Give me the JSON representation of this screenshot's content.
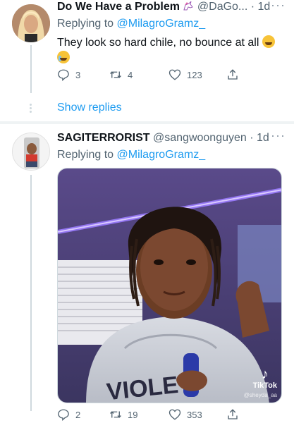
{
  "tweets": [
    {
      "display_name": "Do We Have a Problem",
      "handle": "@DaGo...",
      "time": "· 1d",
      "more": "···",
      "replying_prefix": "Replying to ",
      "replying_to": "@MilagroGramz_",
      "text": "They look so hard chile, no bounce at all",
      "emojis": [
        "tired-face-emoji",
        "crying-face-emoji"
      ],
      "replies": "3",
      "retweets": "4",
      "likes": "123",
      "show_replies": "Show replies"
    },
    {
      "display_name": "SAGITERRORIST",
      "handle": "@sangwoonguyen",
      "time": "· 1d",
      "more": "···",
      "replying_prefix": "Replying to ",
      "replying_to": "@MilagroGramz_",
      "media_watermark": "TikTok",
      "media_watermark_handle": "@sheyda_aa",
      "replies": "2",
      "retweets": "19",
      "likes": "353"
    }
  ],
  "colors": {
    "link": "#1d9bf0",
    "secondary_text": "#536471",
    "primary_text": "#0f1419",
    "thread_line": "#cfd9de"
  }
}
